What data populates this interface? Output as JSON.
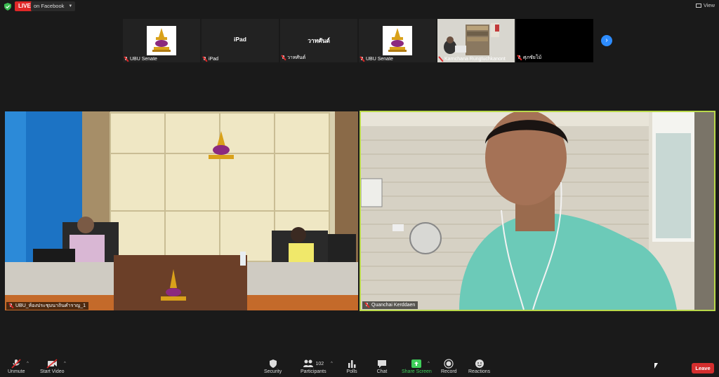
{
  "topbar": {
    "live_badge": "LIVE",
    "live_target": "on Facebook",
    "view_label": "View"
  },
  "thumbnails": [
    {
      "label": "UBU Senate",
      "type": "logo",
      "center_name": ""
    },
    {
      "label": "iPad",
      "type": "name",
      "center_name": "iPad"
    },
    {
      "label": "วาทศันต์",
      "type": "name",
      "center_name": "วาทศันต์"
    },
    {
      "label": "UBU Senate",
      "type": "logo",
      "center_name": ""
    },
    {
      "label": "Karnchana Rungtuchkanont",
      "type": "photo",
      "center_name": ""
    },
    {
      "label": "ศุภชัยโม้",
      "type": "black",
      "center_name": ""
    }
  ],
  "main_videos": {
    "left_name": "UBU_ห้องประชุมนาถินคำราญ_1",
    "right_name": "Quanchai Kerddaen"
  },
  "toolbar": {
    "unmute": "Unmute",
    "start_video": "Start Video",
    "security": "Security",
    "participants": "Participants",
    "participants_count": "102",
    "polls": "Polls",
    "chat": "Chat",
    "share_screen": "Share Screen",
    "record": "Record",
    "reactions": "Reactions",
    "leave": "Leave"
  },
  "colors": {
    "live_red": "#e02828",
    "active_speaker_border": "#b9d84a",
    "share_green": "#3fcf5a",
    "leave_red": "#d42e2e",
    "next_blue": "#2d8cff"
  }
}
